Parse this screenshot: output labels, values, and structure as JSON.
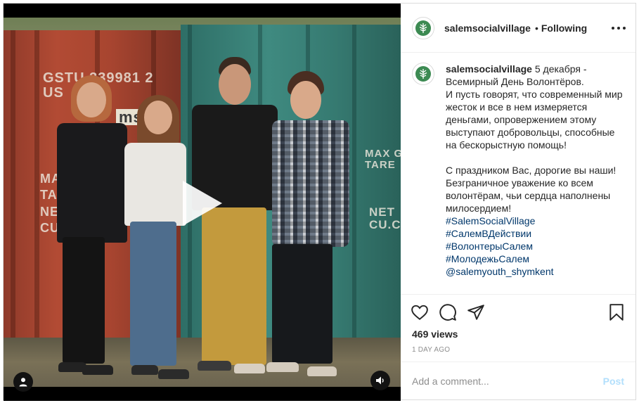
{
  "post": {
    "username": "salemsocialvillage",
    "separator": "•",
    "follow_status": "Following",
    "more_icon": "ellipsis-icon"
  },
  "media": {
    "type": "video",
    "stencil_red": "GSTU 339981 2\nUS    310",
    "stencil_msc": "msc",
    "stencil_left": "MA\nTA\nNE\nCU",
    "stencil_teal_1": "MAX GROSS\nTARE",
    "stencil_teal_2": "NET\nCU.CAP.",
    "icons": [
      "play-icon",
      "user-tag-icon",
      "audio-icon"
    ]
  },
  "caption": {
    "username": "salemsocialvillage",
    "text_1": "5 декабря - Всемирный День Волонтёров.",
    "text_2": "И пусть говорят, что современный мир жесток и все в нем измеряется деньгами, опровержением этому выступают добровольцы, способные на бескорыстную помощь!",
    "text_3": "С праздником Вас, дорогие вы наши! Безграничное уважение ко всем волонтёрам, чьи сердца наполнены милосердием!",
    "hashtags": [
      "#SalemSocialVillage",
      "#СалемВДействии",
      "#ВолонтерыСалем",
      "#МолодежьСалем",
      "@salemyouth_shymkent"
    ]
  },
  "actions": {
    "icons": [
      "heart-icon",
      "comment-icon",
      "share-icon",
      "bookmark-icon"
    ],
    "views": "469 views",
    "date": "1 DAY AGO"
  },
  "comment": {
    "placeholder": "Add a comment...",
    "post_label": "Post"
  },
  "colors": {
    "link": "#00376b",
    "post_disabled": "#b2dffc",
    "muted": "#8e8e8e",
    "border": "#dbdbdb"
  }
}
